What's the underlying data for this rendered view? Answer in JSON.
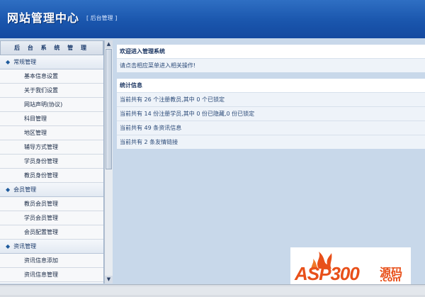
{
  "header": {
    "title": "网站管理中心",
    "subtitle": "[ 后台管理 ]"
  },
  "sidebar": {
    "heading": "后 台 系 统 管 理",
    "groups": [
      {
        "label": "常规管理",
        "items": [
          "基本信息设置",
          "关于我们设置",
          "网站声明(协议)",
          "科目管理",
          "地区管理",
          "辅导方式管理",
          "学员身份管理",
          "教员身份管理"
        ]
      },
      {
        "label": "会员管理",
        "items": [
          "教员会员管理",
          "学员会员管理",
          "会员配置管理"
        ]
      },
      {
        "label": "资讯管理",
        "items": [
          "资讯信息添加",
          "资讯信息管理"
        ]
      }
    ]
  },
  "welcome": {
    "title": "欢迎进入管理系统",
    "text": "请点击相应菜单进入相关操作!"
  },
  "stats": {
    "title": "统计信息",
    "rows": [
      "当前共有 26 个注册教员,其中 0 个已锁定",
      "当前共有 14 份注册学员,其中 0 份已隐藏,0 份已锁定",
      "当前共有 49 条资讯信息",
      "当前共有 2 条友情链接"
    ]
  },
  "watermark": {
    "brand": "ASP300",
    "cn": "源码",
    "domain": ".com"
  },
  "colors": {
    "header_blue": "#1a56ad",
    "link_text": "#2b4a78",
    "accent_orange": "#e8501a"
  }
}
